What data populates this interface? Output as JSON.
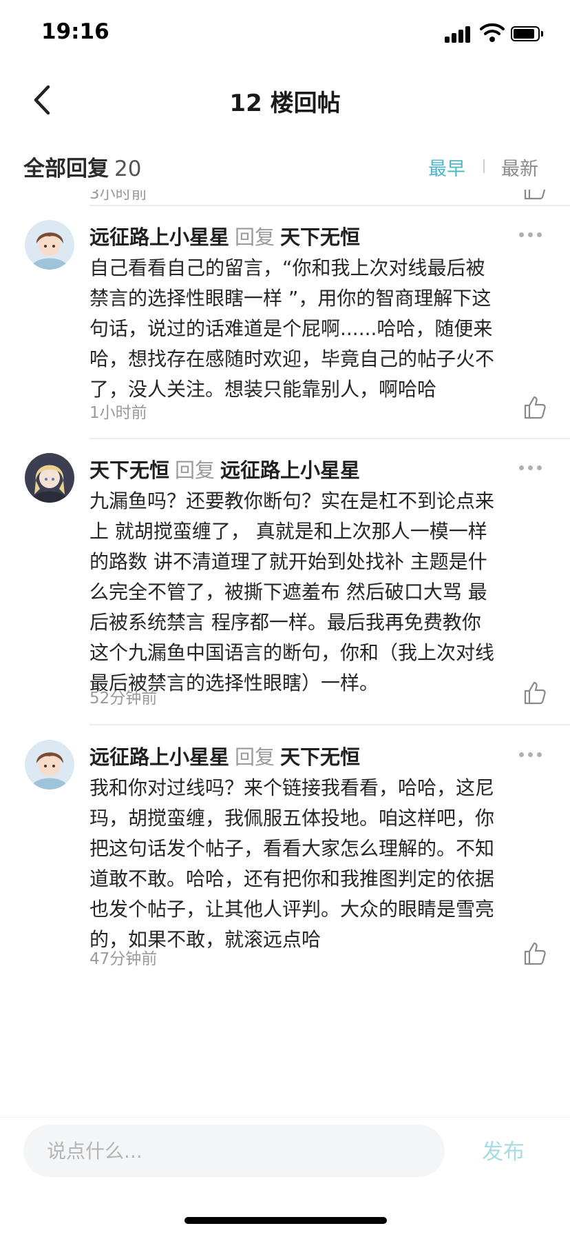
{
  "status_bar": {
    "time": "19:16"
  },
  "nav": {
    "title": "12 楼回帖"
  },
  "section": {
    "title": "全部回复",
    "count": "20",
    "sort_earliest": "最早",
    "sort_newest": "最新",
    "active_sort": "最早"
  },
  "previous": {
    "time": "3小时前"
  },
  "replies": [
    {
      "author": "远征路上小星星",
      "reply_word": "回复",
      "target": "天下无恒",
      "body": "自己看看自己的留言，“你和我上次对线最后被\n禁言的选择性眼瞎一样 ”，用你的智商理解下这\n句话，说过的话难道是个屁啊......哈哈，随便来\n哈，想找存在感随时欢迎，毕竟自己的帖子火不\n了，没人关注。想装只能靠别人，啊哈哈",
      "time": "1小时前"
    },
    {
      "author": "天下无恒",
      "reply_word": "回复",
      "target": "远征路上小星星",
      "body": "九漏鱼吗？还要教你断句？实在是杠不到论点来\n上 就胡搅蛮缠了， 真就是和上次那人一模一样\n的路数 讲不清道理了就开始到处找补 主题是什\n么完全不管了，被撕下遮羞布 然后破口大骂 最\n后被系统禁言 程序都一样。最后我再免费教你\n这个九漏鱼中国语言的断句，你和（我上次对线\n最后被禁言的选择性眼瞎）一样。",
      "time": "52分钟前"
    },
    {
      "author": "远征路上小星星",
      "reply_word": "回复",
      "target": "天下无恒",
      "body": "我和你对过线吗？来个链接我看看，哈哈，这尼\n玛，胡搅蛮缠，我佩服五体投地。咱这样吧，你\n把这句话发个帖子，看看大家怎么理解的。不知\n道敢不敢。哈哈，还有把你和我推图判定的依据\n也发个帖子，让其他人评判。大众的眼睛是雪亮\n的，如果不敢，就滚远点哈",
      "time": "47分钟前"
    }
  ],
  "input": {
    "placeholder": "说点什么...",
    "value": ""
  },
  "publish": {
    "label": "发布"
  },
  "colors": {
    "accent": "#4fb6c9",
    "publish_disabled": "#a8dbe4",
    "muted": "#9a9a9a"
  }
}
